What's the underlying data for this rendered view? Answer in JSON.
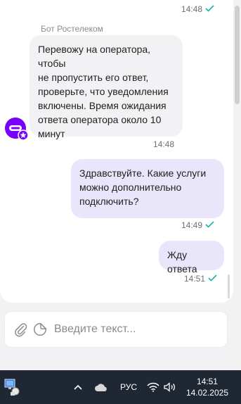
{
  "messages": [
    {
      "time": "14:48"
    },
    {
      "sender": "Бот Ростелеком",
      "text": "Перевожу на оператора, чтобы\nне пропустить его ответ,\nпроверьте, что уведомления\nвключены. Время ожидания\nответа оператора около 10\nминут",
      "time": "14:48"
    },
    {
      "text": "Здравствуйте. Какие услуги\nможно дополнительно\nподключить?",
      "time": "14:49"
    },
    {
      "text": "Жду ответа",
      "time": "14:51"
    }
  ],
  "composer": {
    "placeholder": "Введите текст..."
  },
  "taskbar": {
    "language": "РУС",
    "time": "14:51",
    "date": "14.02.2025"
  },
  "colors": {
    "accent": "#7700ff",
    "check": "#19b3a6",
    "outgoing_bubble": "#e9e6fb",
    "incoming_bubble": "#f2f2f5",
    "taskbar": "#1f2733"
  },
  "icons": [
    "double-check-icon",
    "bot-avatar-icon",
    "paperclip-icon",
    "sticker-icon",
    "chevron-up-icon",
    "cloud-icon",
    "wifi-icon",
    "speaker-icon",
    "network-app-icon"
  ]
}
